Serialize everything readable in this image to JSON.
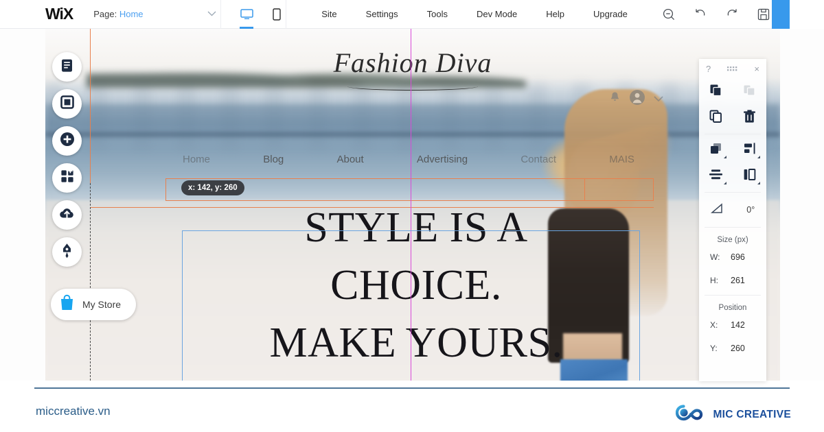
{
  "toolbar": {
    "logo": "WiX",
    "page_label": "Page:",
    "page_value": "Home",
    "chevron": "∨",
    "desktop_icon": "desktop-icon",
    "mobile_icon": "mobile-icon",
    "menu": [
      {
        "label": "Site"
      },
      {
        "label": "Settings"
      },
      {
        "label": "Tools"
      },
      {
        "label": "Dev Mode"
      },
      {
        "label": "Help"
      },
      {
        "label": "Upgrade"
      }
    ],
    "icons": [
      {
        "name": "zoom-out-icon"
      },
      {
        "name": "undo-icon"
      },
      {
        "name": "redo-icon"
      },
      {
        "name": "save-icon"
      },
      {
        "name": "preview-icon"
      }
    ],
    "publish_button": ""
  },
  "sidebar": {
    "items": [
      {
        "name": "menus-and-pages-icon"
      },
      {
        "name": "background-icon"
      },
      {
        "name": "add-elements-icon"
      },
      {
        "name": "add-apps-icon"
      },
      {
        "name": "my-uploads-icon"
      },
      {
        "name": "blog-icon"
      }
    ],
    "store": {
      "icon": "shopping-bag-icon",
      "label": "My Store"
    }
  },
  "canvas": {
    "site_logo": "Fashion Diva",
    "nav": [
      {
        "label": "Home",
        "dim": true
      },
      {
        "label": "Blog",
        "dim": false
      },
      {
        "label": "About",
        "dim": false
      },
      {
        "label": "Advertising",
        "dim": false
      },
      {
        "label": "Contact",
        "dim": true
      },
      {
        "label": "MAIS",
        "dim": true
      }
    ],
    "headline_lines": [
      "STYLE IS A",
      "CHOICE.",
      "MAKE YOURS."
    ],
    "account_icons": [
      {
        "name": "bell-icon"
      },
      {
        "name": "avatar-icon"
      },
      {
        "name": "chevron-down-icon"
      }
    ],
    "coordinate_tooltip": "x: 142, y: 260",
    "guide_color": "#e8804d",
    "center_guide_color": "#d94ad9",
    "selection_color": "#6aa4e0"
  },
  "tool_panel": {
    "help_icon": "?",
    "drag_handle_icon": "drag-dots-icon",
    "close_icon": "×",
    "actions": [
      {
        "name": "copy-style-icon",
        "disabled": false
      },
      {
        "name": "paste-style-icon",
        "disabled": true
      },
      {
        "name": "duplicate-icon",
        "disabled": false
      },
      {
        "name": "delete-icon",
        "disabled": false
      },
      {
        "name": "arrange-icon",
        "disabled": false
      },
      {
        "name": "align-icon",
        "disabled": false
      },
      {
        "name": "distribute-icon",
        "disabled": false
      },
      {
        "name": "match-size-icon",
        "disabled": false
      }
    ],
    "rotation": {
      "icon": "rotation-icon",
      "value": "0°"
    },
    "size": {
      "title": "Size (px)",
      "rows": [
        {
          "key": "W:",
          "value": "696"
        },
        {
          "key": "H:",
          "value": "261"
        }
      ]
    },
    "position": {
      "title": "Position",
      "rows": [
        {
          "key": "X:",
          "value": "142"
        },
        {
          "key": "Y:",
          "value": "260"
        }
      ]
    }
  },
  "footer": {
    "site": "miccreative.vn",
    "brand": "MIC CREATIVE",
    "brand_icon": "mic-infinity-logo",
    "accent": "#1b4f9c"
  }
}
